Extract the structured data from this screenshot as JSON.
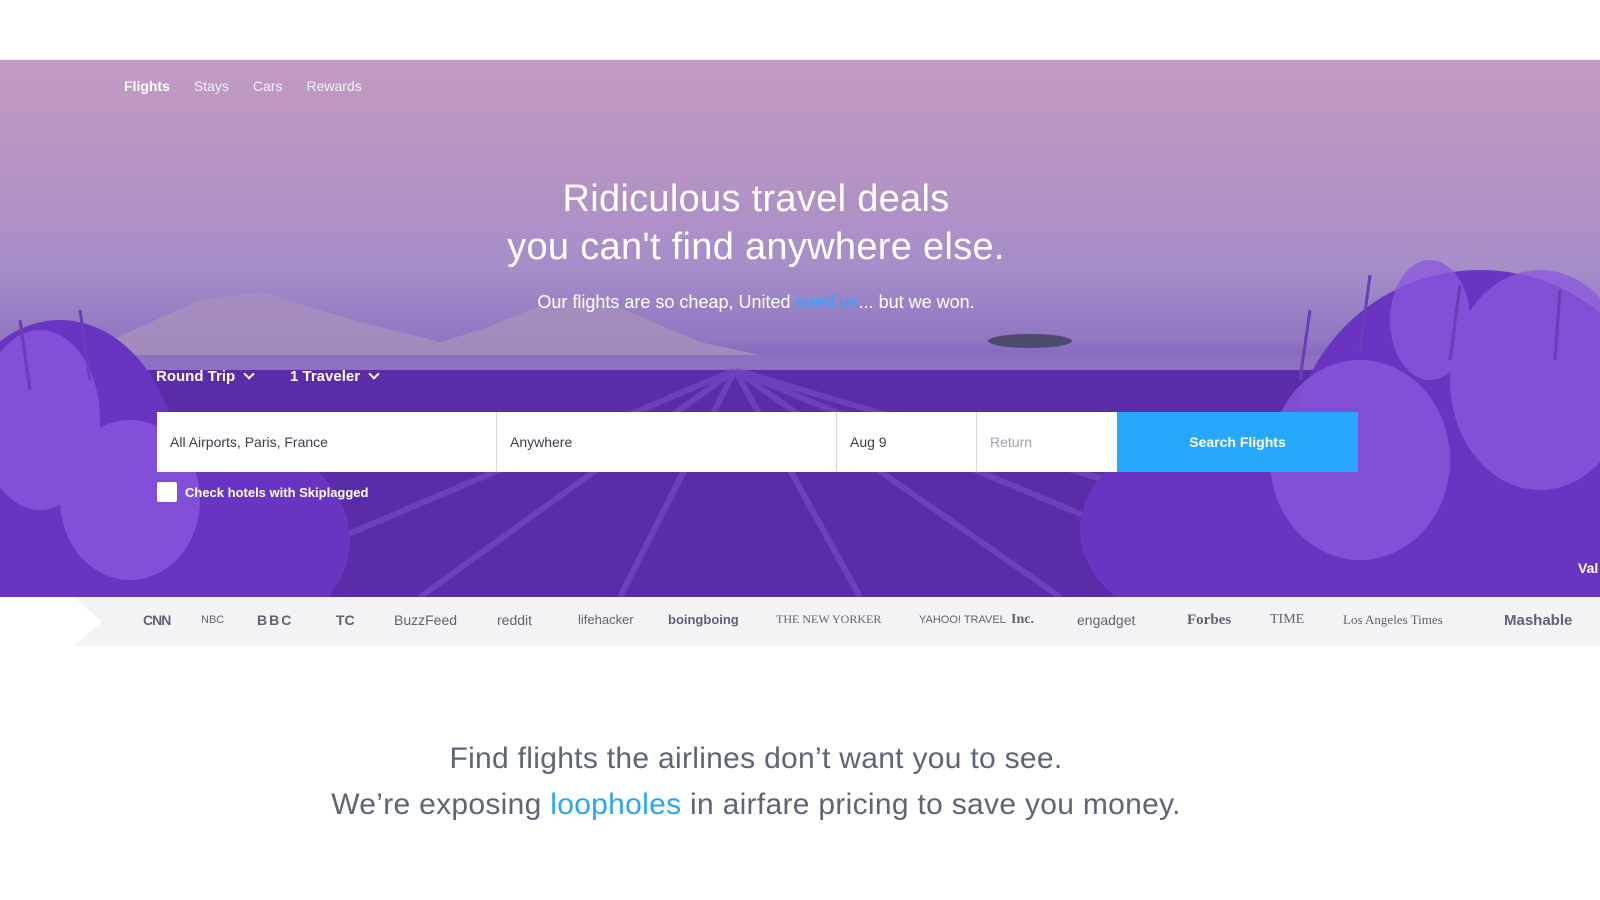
{
  "nav": {
    "items": [
      {
        "label": "Flights",
        "active": true
      },
      {
        "label": "Stays"
      },
      {
        "label": "Cars"
      },
      {
        "label": "Rewards"
      }
    ]
  },
  "hero": {
    "headline_line1": "Ridiculous travel deals",
    "headline_line2": "you can't find anywhere else.",
    "sub_before": "Our flights are so cheap, United ",
    "sub_link": "sued us",
    "sub_after": "... but we won."
  },
  "search": {
    "trip_type": "Round Trip",
    "travelers": "1 Traveler",
    "origin": "All Airports, Paris, France",
    "destination": "Anywhere",
    "depart_date": "Aug 9",
    "return_placeholder": "Return",
    "button_label": "Search Flights",
    "hotel_check_label": "Check hotels with Skiplagged",
    "hotel_check_checked": false
  },
  "hero_edge_text": "Val",
  "press_logos": [
    "CNN",
    "NBC",
    "BBC",
    "TC",
    "BuzzFeed",
    "reddit",
    "lifehacker",
    "boingboing",
    "THE NEW YORKER",
    "YAHOO! TRAVEL",
    "Inc.",
    "engadget",
    "Forbes",
    "TIME",
    "Los Angeles Times",
    "Mashable"
  ],
  "tagline": {
    "line1": "Find flights the airlines don’t want you to see.",
    "line2_before": "We’re exposing ",
    "line2_link": "loopholes",
    "line2_after": " in airfare pricing to save you money."
  },
  "colors": {
    "accent": "#27a8fe",
    "link": "#2aa7ef",
    "text_gray": "#5c6674",
    "lavender_dark": "#4a2196",
    "sky": "#c19bc2"
  }
}
